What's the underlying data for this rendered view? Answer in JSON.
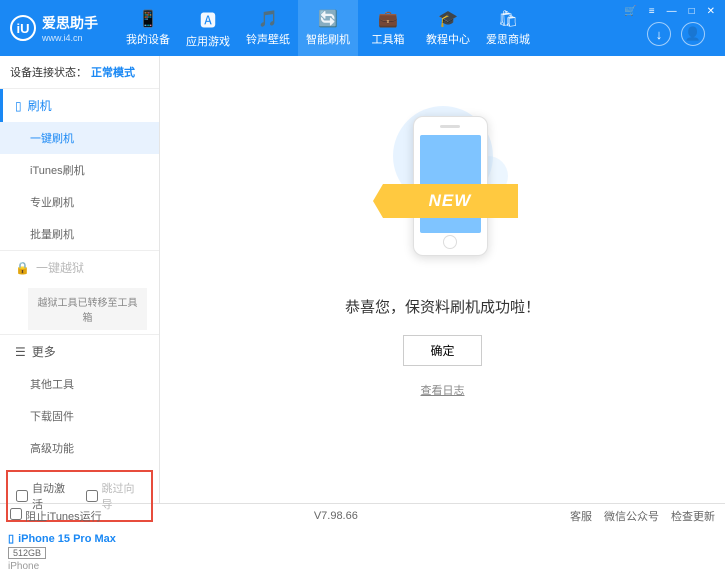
{
  "app": {
    "name": "爱思助手",
    "url": "www.i4.cn",
    "logo_letter": "iU"
  },
  "titlebar": {
    "cart": "🛒",
    "menu": "≡",
    "min": "—",
    "max": "□",
    "close": "✕"
  },
  "nav": [
    {
      "icon": "📱",
      "label": "我的设备"
    },
    {
      "icon": "🅰",
      "label": "应用游戏"
    },
    {
      "icon": "🎵",
      "label": "铃声壁纸"
    },
    {
      "icon": "🔄",
      "label": "智能刷机",
      "active": true
    },
    {
      "icon": "💼",
      "label": "工具箱"
    },
    {
      "icon": "🎓",
      "label": "教程中心"
    },
    {
      "icon": "🛍",
      "label": "爱思商城"
    }
  ],
  "header_btns": {
    "download": "↓",
    "user": "👤"
  },
  "status": {
    "label": "设备连接状态：",
    "value": "正常模式"
  },
  "sidebar": {
    "flash_head": "刷机",
    "flash_items": [
      "一键刷机",
      "iTunes刷机",
      "专业刷机",
      "批量刷机"
    ],
    "jailbreak_head": "一键越狱",
    "jailbreak_note": "越狱工具已转移至工具箱",
    "more_head": "更多",
    "more_items": [
      "其他工具",
      "下载固件",
      "高级功能"
    ],
    "options": {
      "auto_activate": "自动激活",
      "skip_guide": "跳过向导"
    },
    "device": {
      "name": "iPhone 15 Pro Max",
      "storage": "512GB",
      "type": "iPhone"
    }
  },
  "main": {
    "ribbon": "NEW",
    "message": "恭喜您，保资料刷机成功啦！",
    "ok": "确定",
    "view_log": "查看日志"
  },
  "footer": {
    "block_itunes": "阻止iTunes运行",
    "version": "V7.98.66",
    "links": [
      "客服",
      "微信公众号",
      "检查更新"
    ]
  }
}
